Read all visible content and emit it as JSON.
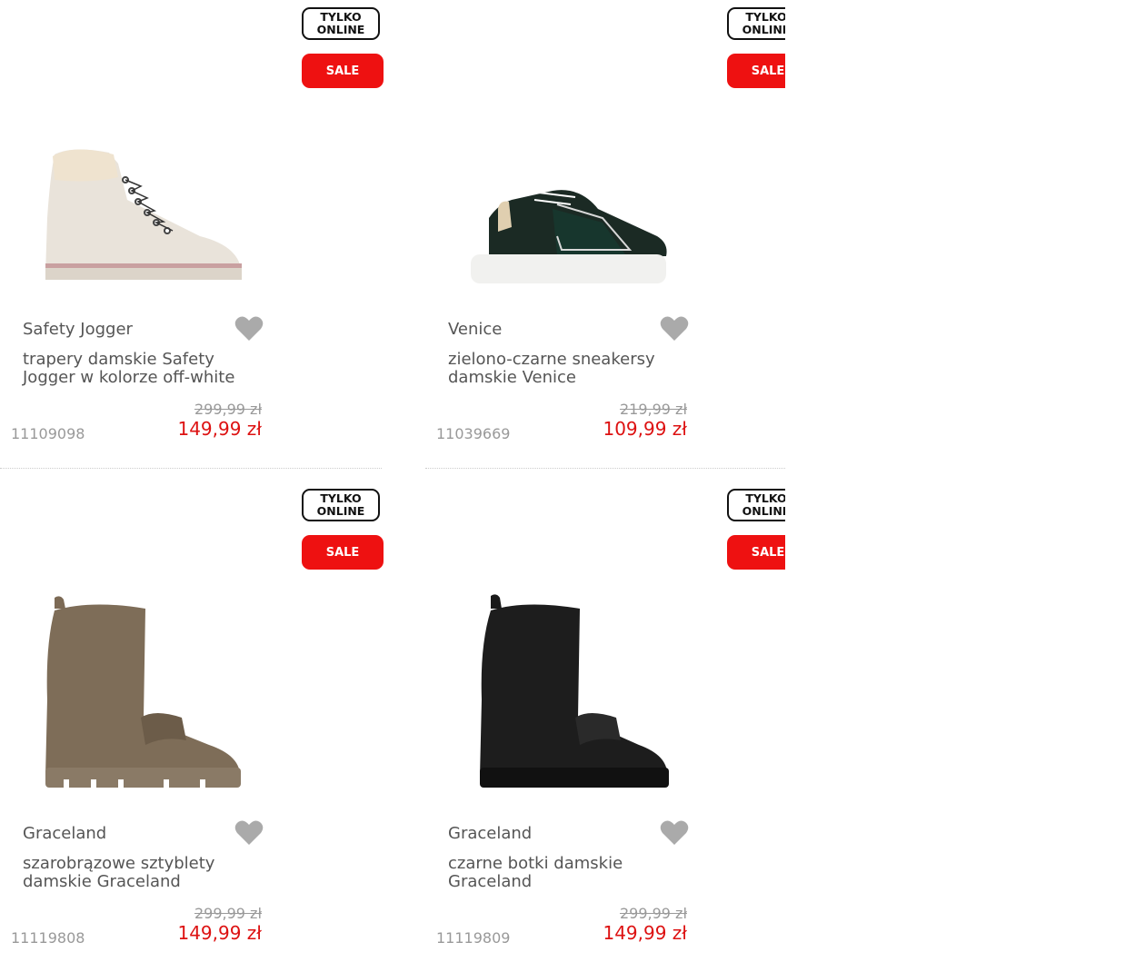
{
  "badges": {
    "online": "TYLKO ONLINE",
    "online_l1": "TYLKO",
    "online_l2": "ONLINE",
    "sale": "SALE"
  },
  "products": [
    {
      "brand": "Safety Jogger",
      "title": "trapery damskie Safety Jogger w kolorze off-white",
      "old_price": "299,99 zł",
      "price": "149,99 zł",
      "sku": "11109098",
      "image": "off-white-hiking-boot"
    },
    {
      "brand": "Venice",
      "title": "zielono-czarne sneakersy damskie Venice",
      "old_price": "219,99 zł",
      "price": "109,99 zł",
      "sku": "11039669",
      "image": "black-green-sneaker"
    },
    {
      "brand": "Graceland",
      "title": "szarobrązowe sztyblety damskie Graceland",
      "old_price": "299,99 zł",
      "price": "149,99 zł",
      "sku": "11119808",
      "image": "taupe-chelsea-boot"
    },
    {
      "brand": "Graceland",
      "title": "czarne botki damskie Graceland",
      "old_price": "299,99 zł",
      "price": "149,99 zł",
      "sku": "11119809",
      "image": "black-chelsea-boot"
    }
  ],
  "colors": {
    "sale": "#ee1111",
    "price": "#dd1111",
    "muted": "#999999",
    "text": "#555555",
    "heart": "#aaaaaa"
  }
}
